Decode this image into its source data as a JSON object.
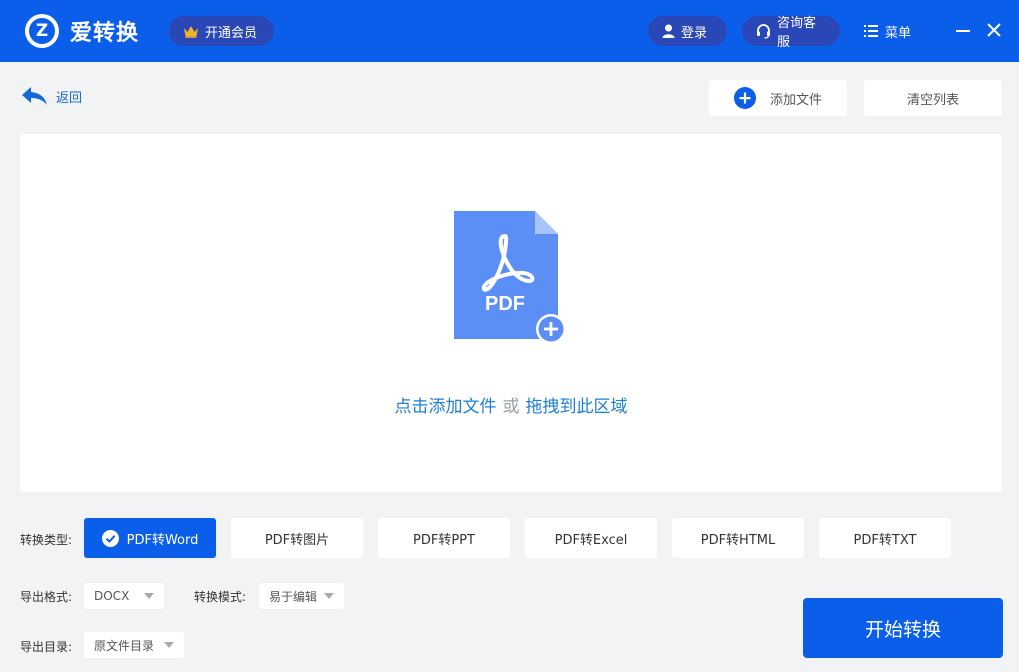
{
  "header": {
    "logo_letter": "Z",
    "app_title": "爱转换",
    "vip_label": "开通会员",
    "login_label": "登录",
    "service_label": "咨询客服",
    "menu_label": "菜单"
  },
  "toolbar": {
    "back_label": "返回",
    "add_file_label": "添加文件",
    "clear_list_label": "清空列表"
  },
  "dropzone": {
    "pdf_icon_text": "PDF",
    "click_add": "点击添加文件",
    "or": "或",
    "drag_here": "拖拽到此区域"
  },
  "conversion": {
    "type_label": "转换类型:",
    "types": [
      {
        "label": "PDF转Word",
        "active": true
      },
      {
        "label": "PDF转图片",
        "active": false
      },
      {
        "label": "PDF转PPT",
        "active": false
      },
      {
        "label": "PDF转Excel",
        "active": false
      },
      {
        "label": "PDF转HTML",
        "active": false
      },
      {
        "label": "PDF转TXT",
        "active": false
      }
    ],
    "format_label": "导出格式:",
    "format_value": "DOCX",
    "mode_label": "转换模式:",
    "mode_value": "易于编辑",
    "dir_label": "导出目录:",
    "dir_value": "原文件目录",
    "start_label": "开始转换"
  },
  "colors": {
    "primary": "#0a5ee9",
    "header_pill": "#2a47b8",
    "link": "#1e7fd6",
    "pdf_icon": "#5b8ff5",
    "crown": "#f5b324"
  }
}
